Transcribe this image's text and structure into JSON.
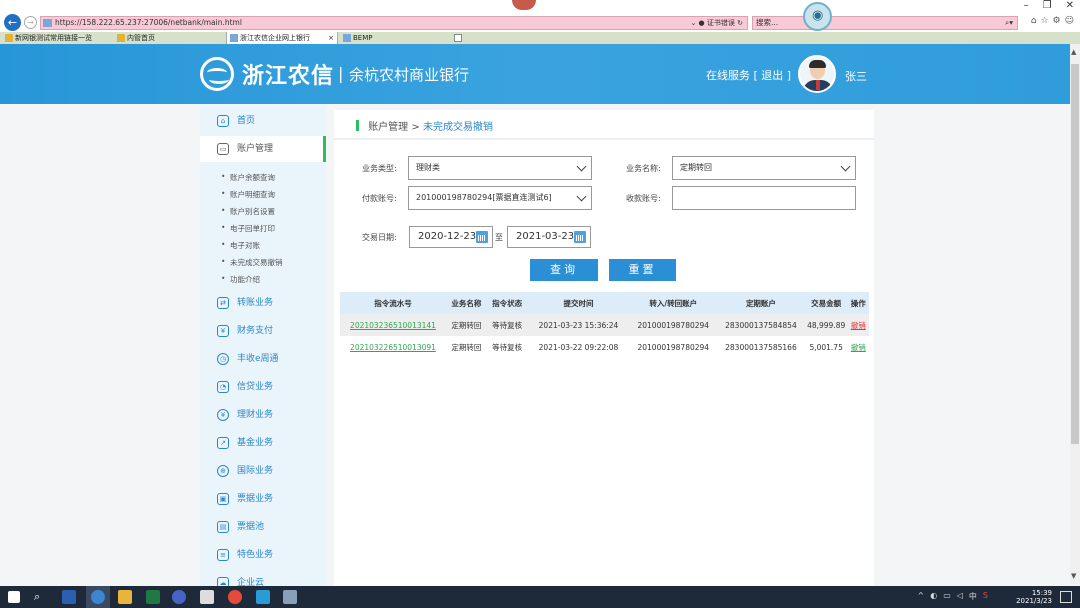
{
  "browser": {
    "url": "https://158.222.65.237:27006/netbank/main.html",
    "cert_error": "证书错误",
    "search_placeholder": "搜索...",
    "tabs": [
      {
        "label": "新网银测试常用链接一览"
      },
      {
        "label": "内管首页"
      },
      {
        "label": "浙江农信企业网上银行",
        "active": true
      },
      {
        "label": "BEMP"
      }
    ]
  },
  "header": {
    "logo": "浙江农信",
    "separator": "|",
    "bank_name": "余杭农村商业银行",
    "online_service": "在线服务",
    "logout": "[ 退出 ]",
    "user_name": "张三"
  },
  "sidebar": {
    "items": [
      {
        "label": "首页",
        "icon": "home-icon"
      },
      {
        "label": "账户管理",
        "icon": "card-icon",
        "selected": true
      },
      {
        "label": "转账业务",
        "icon": "transfer-icon"
      },
      {
        "label": "财务支付",
        "icon": "payment-icon"
      },
      {
        "label": "丰收e周通",
        "icon": "clock-icon"
      },
      {
        "label": "信贷业务",
        "icon": "loan-icon"
      },
      {
        "label": "理财业务",
        "icon": "wealth-icon"
      },
      {
        "label": "基金业务",
        "icon": "fund-icon"
      },
      {
        "label": "国际业务",
        "icon": "globe-icon"
      },
      {
        "label": "票据业务",
        "icon": "bill-icon"
      },
      {
        "label": "票据池",
        "icon": "pool-icon"
      },
      {
        "label": "特色业务",
        "icon": "special-icon"
      },
      {
        "label": "企业云",
        "icon": "cloud-icon"
      }
    ],
    "sub_items": [
      {
        "label": "账户余额查询"
      },
      {
        "label": "账户明细查询"
      },
      {
        "label": "账户别名设置"
      },
      {
        "label": "电子回单打印"
      },
      {
        "label": "电子对账"
      },
      {
        "label": "未完成交易撤销"
      },
      {
        "label": "功能介绍"
      }
    ]
  },
  "breadcrumb": {
    "parent": "账户管理",
    "sep": ">",
    "current": "未完成交易撤销"
  },
  "form": {
    "biz_type_label": "业务类型:",
    "biz_type_value": "理财类",
    "biz_name_label": "业务名称:",
    "biz_name_value": "定期转回",
    "pay_account_label": "付款账号:",
    "pay_account_value": "201000198780294[票据直连测试6]",
    "recv_account_label": "收款账号:",
    "recv_account_value": "",
    "date_label": "交易日期:",
    "date_from": "2020-12-23",
    "date_to_sep": "至",
    "date_to": "2021-03-23",
    "query_button": "查询",
    "reset_button": "重置"
  },
  "table": {
    "headers": [
      "指令流水号",
      "业务名称",
      "指令状态",
      "提交时间",
      "转入/转回账户",
      "定期账户",
      "交易金额",
      "操作"
    ],
    "rows": [
      [
        "20210323651001314​1",
        "定期转回",
        "等待复核",
        "2021-03-23 15:36:24",
        "201000198780294",
        "283000137584854",
        "48,999.89",
        "撤销"
      ],
      [
        "202103226510013091",
        "定期转回",
        "等待复核",
        "2021-03-22 09:22:08",
        "201000198780294",
        "283000137585166",
        "5,001.75",
        "撤销"
      ]
    ]
  },
  "taskbar": {
    "time": "15:39",
    "date": "2021/3/23"
  }
}
